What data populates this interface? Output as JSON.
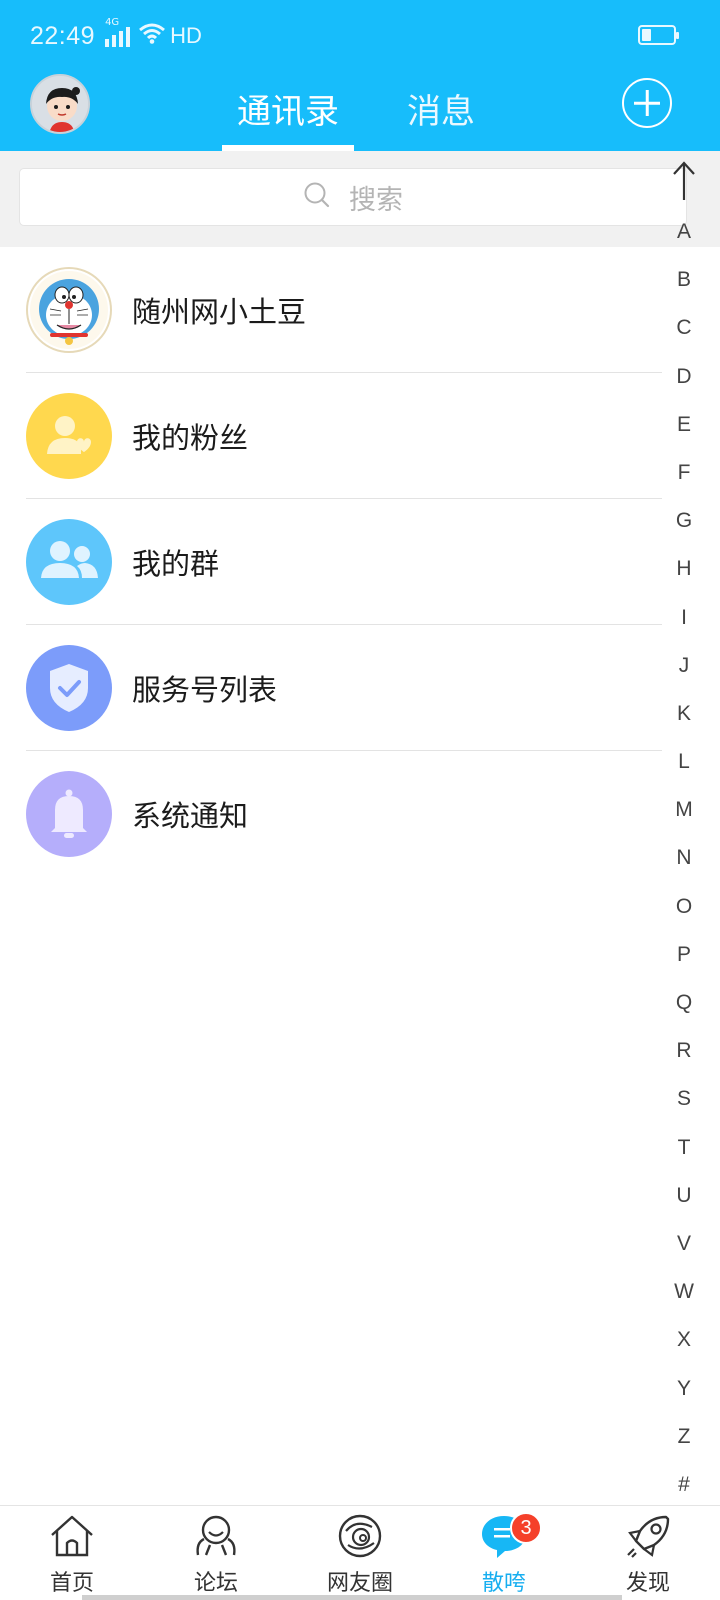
{
  "status_bar": {
    "time": "22:49",
    "network": "4G",
    "hd": "HD",
    "battery_level": 0.25
  },
  "header": {
    "tabs": [
      {
        "label": "通讯录",
        "active": true
      },
      {
        "label": "消息",
        "active": false
      }
    ],
    "add_icon": "plus-circle-icon",
    "accent_color": "#17bdfb"
  },
  "search": {
    "placeholder": "搜索",
    "icon": "search-icon"
  },
  "contacts": [
    {
      "label": "随州网小土豆",
      "icon": "doraemon-avatar"
    },
    {
      "label": "我的粉丝",
      "icon": "fans-icon",
      "color": "#ffd84e"
    },
    {
      "label": "我的群",
      "icon": "group-icon",
      "color": "#5ec6fb"
    },
    {
      "label": "服务号列表",
      "icon": "shield-check-icon",
      "color": "#7c9cfa"
    },
    {
      "label": "系统通知",
      "icon": "bell-icon",
      "color": "#b5aefb"
    }
  ],
  "index_bar": {
    "top_icon": "arrow-up-icon",
    "letters": [
      "A",
      "B",
      "C",
      "D",
      "E",
      "F",
      "G",
      "H",
      "I",
      "J",
      "K",
      "L",
      "M",
      "N",
      "O",
      "P",
      "Q",
      "R",
      "S",
      "T",
      "U",
      "V",
      "W",
      "X",
      "Y",
      "Z",
      "#"
    ]
  },
  "bottom_nav": {
    "items": [
      {
        "label": "首页",
        "icon": "home-icon"
      },
      {
        "label": "论坛",
        "icon": "forum-icon"
      },
      {
        "label": "网友圈",
        "icon": "planet-icon"
      },
      {
        "label": "散咵",
        "icon": "chat-bubble-icon",
        "active": true,
        "badge": "3"
      },
      {
        "label": "发现",
        "icon": "rocket-icon"
      }
    ]
  }
}
